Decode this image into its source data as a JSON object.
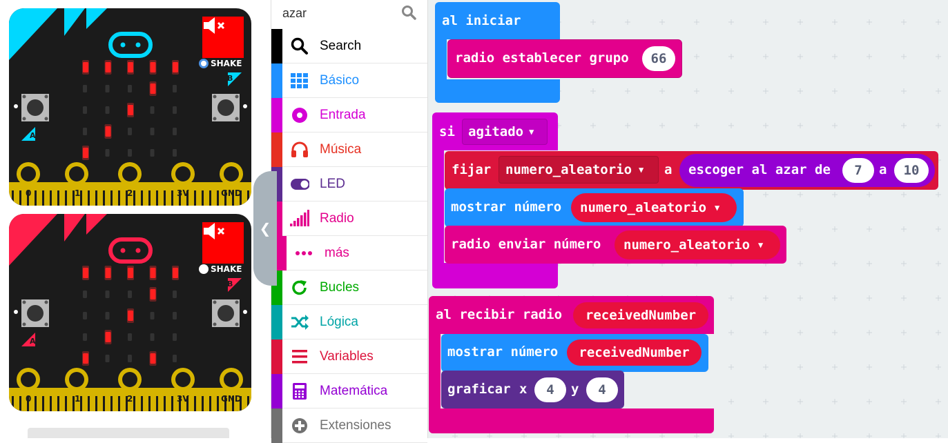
{
  "search": {
    "value": "azar",
    "icon": "search-icon"
  },
  "simulator": {
    "pins": [
      "0",
      "1",
      "2",
      "3V",
      "GND"
    ],
    "button_a": "A",
    "button_b": "B",
    "shake_label": "SHAKE",
    "board1_color": "#00d8ff",
    "board2_color": "#ff1f4b"
  },
  "toolbox": {
    "categories": [
      {
        "label": "Search",
        "color": "#000000",
        "icon": "search-icon"
      },
      {
        "label": "Básico",
        "color": "#1e90ff",
        "icon": "grid-icon"
      },
      {
        "label": "Entrada",
        "color": "#d400d4",
        "icon": "radio-button-icon"
      },
      {
        "label": "Música",
        "color": "#e63022",
        "icon": "headphones-icon"
      },
      {
        "label": "LED",
        "color": "#5c2d91",
        "icon": "toggle-icon"
      },
      {
        "label": "Radio",
        "color": "#e3008c",
        "icon": "signal-bars-icon"
      },
      {
        "label": "más",
        "color": "#e3008c",
        "icon": "more-dots-icon"
      },
      {
        "label": "Bucles",
        "color": "#00aa00",
        "icon": "refresh-icon"
      },
      {
        "label": "Lógica",
        "color": "#00a4a6",
        "icon": "shuffle-icon"
      },
      {
        "label": "Variables",
        "color": "#dc143c",
        "icon": "list-icon"
      },
      {
        "label": "Matemática",
        "color": "#9400d3",
        "icon": "calculator-icon"
      },
      {
        "label": "Extensiones",
        "color": "#717171",
        "icon": "plus-circle-icon"
      }
    ]
  },
  "blocks": {
    "on_start": {
      "label": "al iniciar",
      "color": "#1e90ff"
    },
    "set_group": {
      "label": "radio establecer grupo",
      "value": "66",
      "color": "#e3008c"
    },
    "if_shake": {
      "label": "si",
      "dropdown": "agitado",
      "color": "#d400d4"
    },
    "set_var": {
      "label": "fijar",
      "variable": "numero_aleatorio",
      "to": "a",
      "color": "#dc143c"
    },
    "random": {
      "label": "escoger al azar de",
      "from": "7",
      "to_label": "a",
      "to": "10",
      "color": "#9400d3"
    },
    "show_number": {
      "label": "mostrar número",
      "variable": "numero_aleatorio",
      "color": "#1e90ff"
    },
    "send_number": {
      "label": "radio enviar número",
      "variable": "numero_aleatorio",
      "color": "#e3008c"
    },
    "on_received": {
      "label": "al recibir radio",
      "param": "receivedNumber",
      "color": "#e3008c"
    },
    "show_number2": {
      "label": "mostrar número",
      "variable": "receivedNumber",
      "color": "#1e90ff"
    },
    "plot": {
      "label": "graficar",
      "x_label": "x",
      "x": "4",
      "y_label": "y",
      "y": "4",
      "color": "#5c2d91"
    }
  }
}
